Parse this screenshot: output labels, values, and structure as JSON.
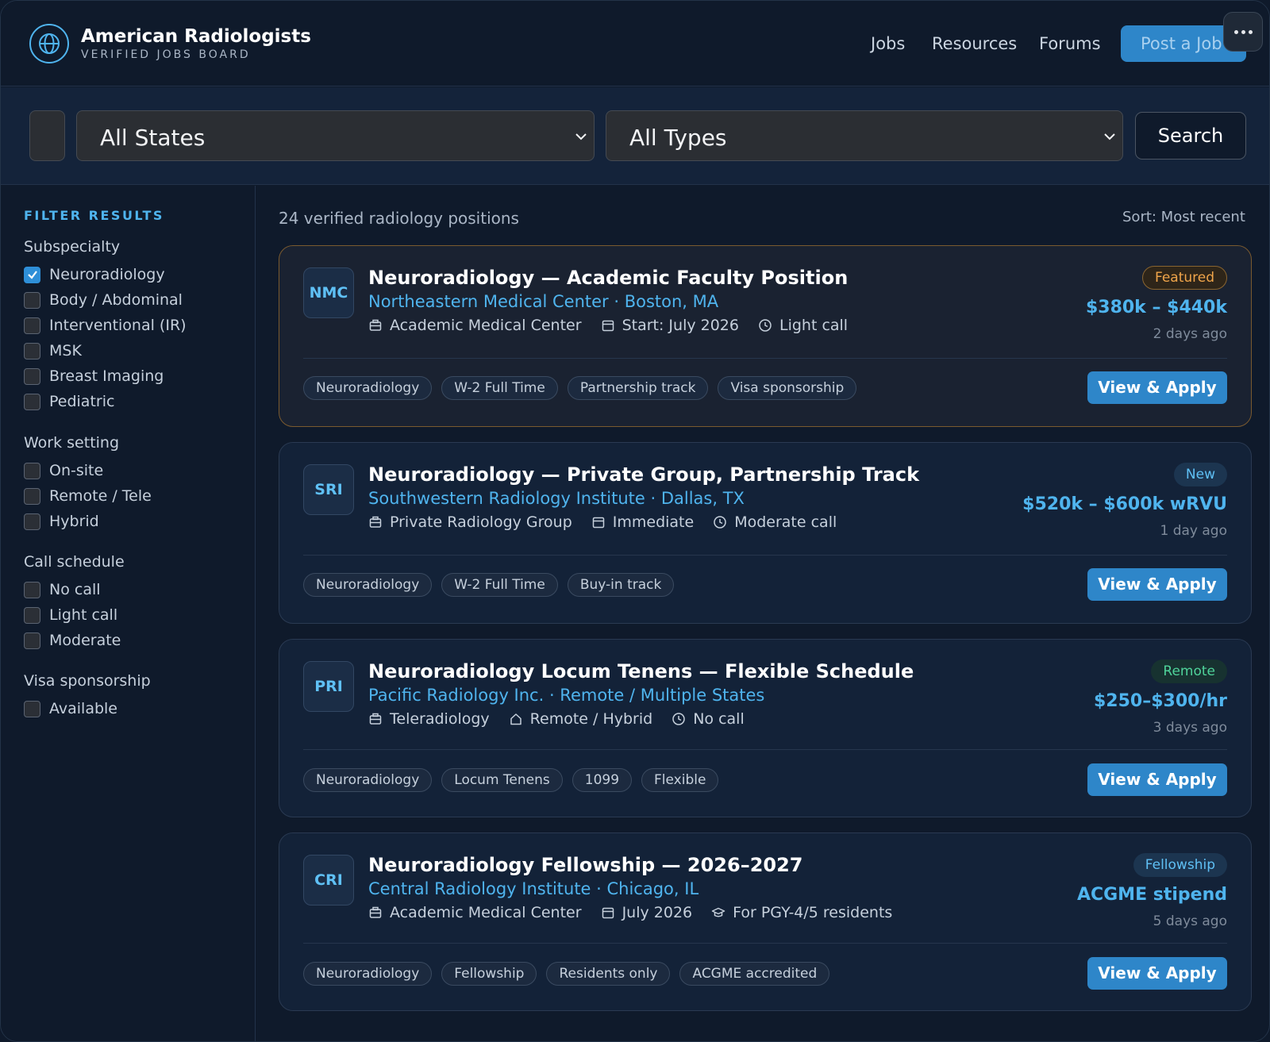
{
  "header": {
    "brand_title": "American Radiologists",
    "brand_subtitle": "VERIFIED JOBS BOARD",
    "logo_icon": "globe-icon",
    "nav": [
      "Jobs",
      "Resources",
      "Forums"
    ],
    "post_button": "Post a Job",
    "more_icon": "more-icon"
  },
  "search": {
    "state_value": "All States",
    "type_value": "All Types",
    "button": "Search"
  },
  "sidebar": {
    "title": "FILTER RESULTS",
    "groups": [
      {
        "label": "Subspecialty",
        "options": [
          {
            "label": "Neuroradiology",
            "checked": true
          },
          {
            "label": "Body / Abdominal",
            "checked": false
          },
          {
            "label": "Interventional (IR)",
            "checked": false
          },
          {
            "label": "MSK",
            "checked": false
          },
          {
            "label": "Breast Imaging",
            "checked": false
          },
          {
            "label": "Pediatric",
            "checked": false
          }
        ]
      },
      {
        "label": "Work setting",
        "options": [
          {
            "label": "On-site",
            "checked": false
          },
          {
            "label": "Remote / Tele",
            "checked": false
          },
          {
            "label": "Hybrid",
            "checked": false
          }
        ]
      },
      {
        "label": "Call schedule",
        "options": [
          {
            "label": "No call",
            "checked": false
          },
          {
            "label": "Light call",
            "checked": false
          },
          {
            "label": "Moderate",
            "checked": false
          }
        ]
      },
      {
        "label": "Visa sponsorship",
        "options": [
          {
            "label": "Available",
            "checked": false
          }
        ]
      }
    ]
  },
  "results": {
    "count_text": "24 verified radiology positions",
    "sort_text": "Sort: Most recent"
  },
  "jobs": [
    {
      "logo": "NMC",
      "title": "Neuroradiology — Academic Faculty Position",
      "org_location": "Northeastern Medical Center · Boston, MA",
      "meta": [
        {
          "icon": "building-icon",
          "text": "Academic Medical Center"
        },
        {
          "icon": "calendar-icon",
          "text": "Start: July 2026"
        },
        {
          "icon": "clock-icon",
          "text": "Light call"
        }
      ],
      "badge": "Featured",
      "badge_kind": "featured",
      "salary": "$380k – $440k",
      "posted": "2 days ago",
      "tags": [
        "Neuroradiology",
        "W-2 Full Time",
        "Partnership track",
        "Visa sponsorship"
      ],
      "apply": "View & Apply"
    },
    {
      "logo": "SRI",
      "title": "Neuroradiology — Private Group, Partnership Track",
      "org_location": "Southwestern Radiology Institute · Dallas, TX",
      "meta": [
        {
          "icon": "building-icon",
          "text": "Private Radiology Group"
        },
        {
          "icon": "calendar-icon",
          "text": "Immediate"
        },
        {
          "icon": "clock-icon",
          "text": "Moderate call"
        }
      ],
      "badge": "New",
      "badge_kind": "new",
      "salary": "$520k – $600k wRVU",
      "posted": "1 day ago",
      "tags": [
        "Neuroradiology",
        "W-2 Full Time",
        "Buy-in track"
      ],
      "apply": "View & Apply"
    },
    {
      "logo": "PRI",
      "title": "Neuroradiology Locum Tenens — Flexible Schedule",
      "org_location": "Pacific Radiology Inc. · Remote / Multiple States",
      "meta": [
        {
          "icon": "building-icon",
          "text": "Teleradiology"
        },
        {
          "icon": "home-icon",
          "text": "Remote / Hybrid"
        },
        {
          "icon": "clock-icon",
          "text": "No call"
        }
      ],
      "badge": "Remote",
      "badge_kind": "remote",
      "salary": "$250–$300/hr",
      "posted": "3 days ago",
      "tags": [
        "Neuroradiology",
        "Locum Tenens",
        "1099",
        "Flexible"
      ],
      "apply": "View & Apply"
    },
    {
      "logo": "CRI",
      "title": "Neuroradiology Fellowship — 2026–2027",
      "org_location": "Central Radiology Institute · Chicago, IL",
      "meta": [
        {
          "icon": "building-icon",
          "text": "Academic Medical Center"
        },
        {
          "icon": "calendar-icon",
          "text": "July 2026"
        },
        {
          "icon": "graduation-cap-icon",
          "text": "For PGY-4/5 residents"
        }
      ],
      "badge": "Fellowship",
      "badge_kind": "fellowship",
      "salary": "ACGME stipend",
      "posted": "5 days ago",
      "tags": [
        "Neuroradiology",
        "Fellowship",
        "Residents only",
        "ACGME accredited"
      ],
      "apply": "View & Apply"
    }
  ],
  "colors": {
    "accent": "#2e86c9",
    "link": "#4fb4ee",
    "background": "#0f1a2b",
    "featured_border": "#7a5a2f"
  }
}
